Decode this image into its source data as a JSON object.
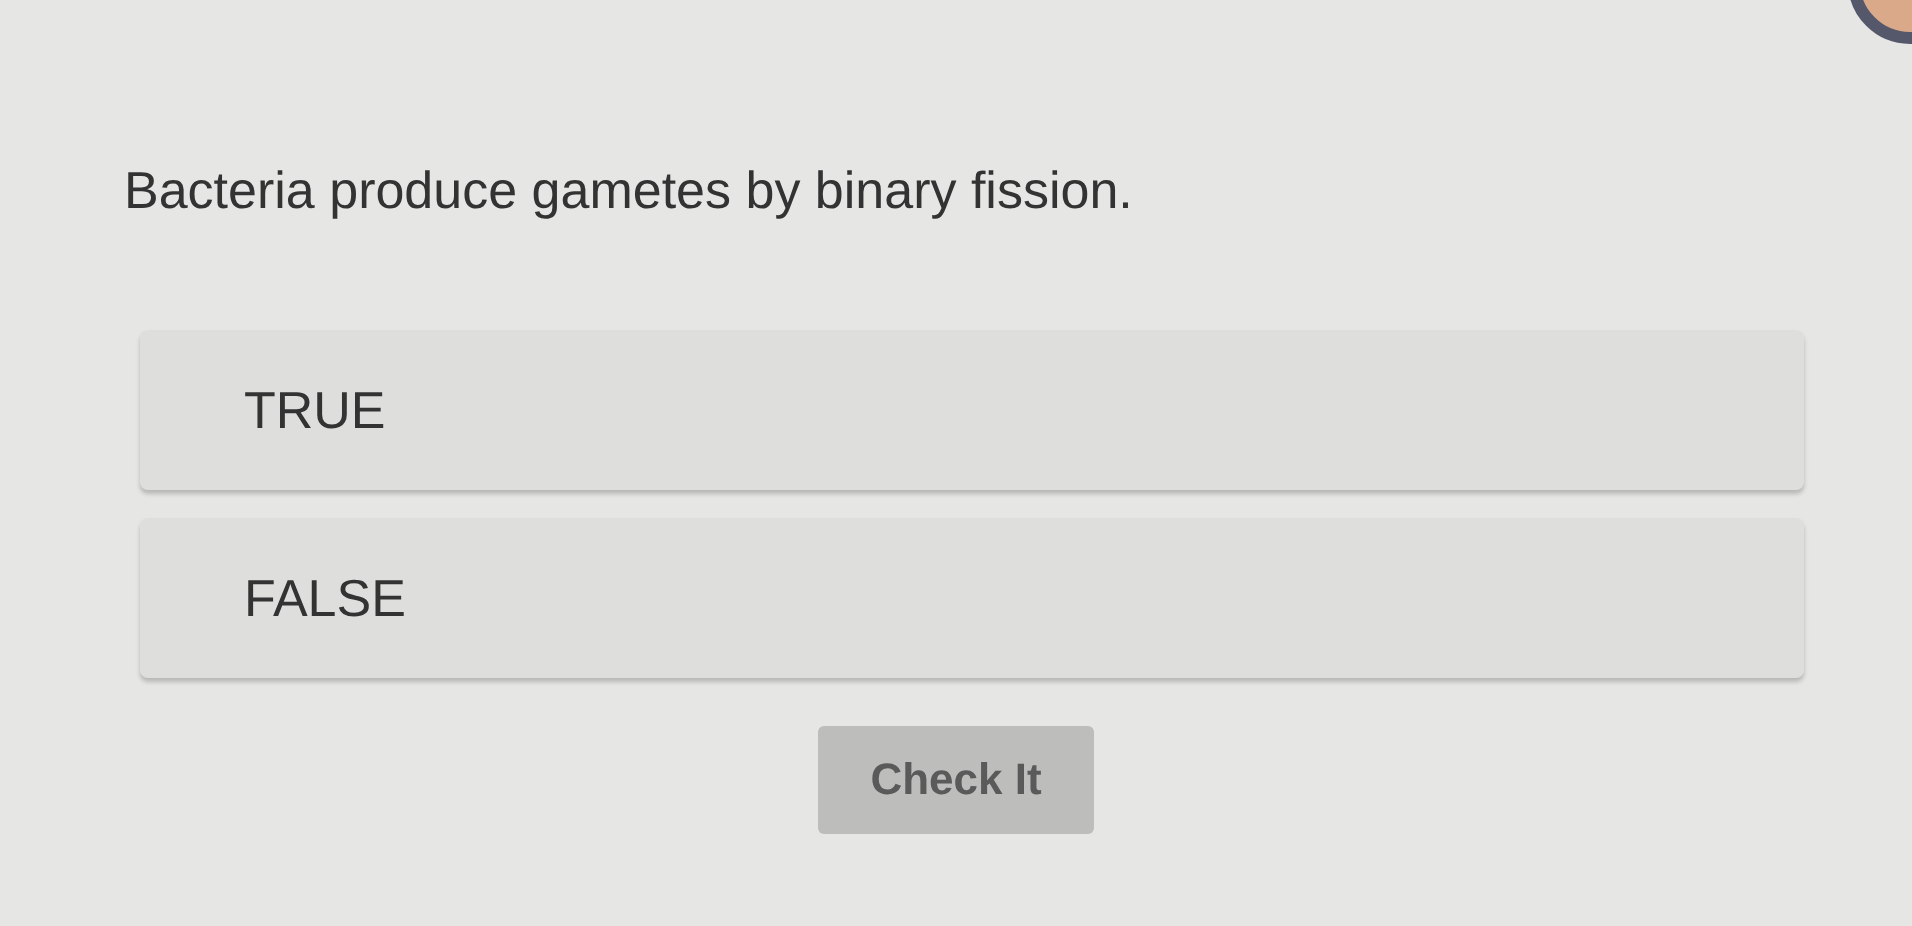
{
  "question": "Bacteria produce gametes by binary fission.",
  "options": [
    {
      "label": "TRUE",
      "selected": false
    },
    {
      "label": "FALSE",
      "selected": false
    }
  ],
  "check_button": {
    "label": "Check It",
    "disabled": true
  }
}
